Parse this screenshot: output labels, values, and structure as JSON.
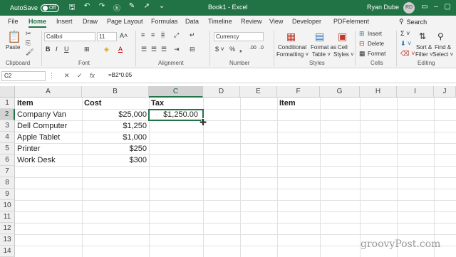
{
  "titlebar": {
    "autosave_label": "AutoSave",
    "autosave_state": "Off",
    "doc_title": "Book1 - Excel",
    "user_name": "Ryan Dube",
    "user_initials": "RD"
  },
  "tabs": [
    "File",
    "Home",
    "Insert",
    "Draw",
    "Page Layout",
    "Formulas",
    "Data",
    "Timeline",
    "Review",
    "View",
    "Developer",
    "PDFelement"
  ],
  "search_label": "Search",
  "ribbon": {
    "clipboard": {
      "paste": "Paste",
      "label": "Clipboard"
    },
    "font": {
      "name": "Calibri",
      "size": "11",
      "label": "Font"
    },
    "alignment": {
      "label": "Alignment"
    },
    "number": {
      "format": "Currency",
      "label": "Number"
    },
    "styles": {
      "conditional": [
        "Conditional",
        "Formatting ˅"
      ],
      "format_table": [
        "Format as",
        "Table ˅"
      ],
      "cell_styles": [
        "Cell",
        "Styles ˅"
      ],
      "label": "Styles"
    },
    "cells": {
      "insert": "Insert",
      "delete": "Delete",
      "format": "Format",
      "label": "Cells"
    },
    "editing": {
      "sort": [
        "Sort &",
        "Filter ˅"
      ],
      "find": [
        "Find &",
        "Select ˅"
      ],
      "label": "Editing"
    }
  },
  "formula_bar": {
    "name_box": "C2",
    "formula": "=B2*0.05"
  },
  "columns": [
    "A",
    "B",
    "C",
    "D",
    "E",
    "F",
    "G",
    "H",
    "I",
    "J"
  ],
  "rows": [
    "1",
    "2",
    "3",
    "4",
    "5",
    "6",
    "7",
    "8",
    "9",
    "10",
    "11",
    "12",
    "13",
    "14"
  ],
  "cells": {
    "A1": "Item",
    "B1": "Cost",
    "C1": "Tax",
    "F1": "Item",
    "A2": "Company Van",
    "B2": "$25,000",
    "C2": "$1,250.00",
    "A3": "Dell Computer",
    "B3": "$1,250",
    "A4": "Apple Tablet",
    "B4": "$1,000",
    "A5": "Printer",
    "B5": "$250",
    "A6": "Work Desk",
    "B6": "$300"
  },
  "watermark": "groovyPost.com"
}
